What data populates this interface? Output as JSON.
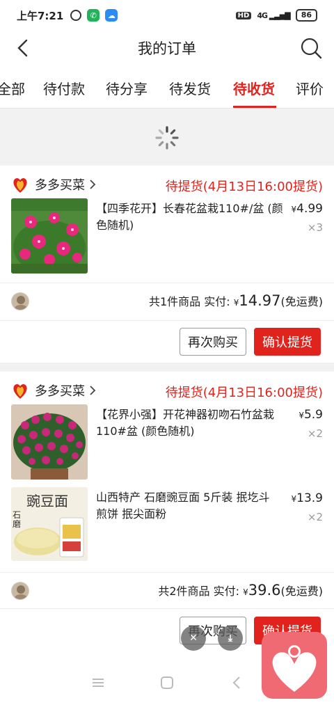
{
  "status_bar": {
    "time": "上午7:21",
    "hd": "HD",
    "network": "4G",
    "battery": "86"
  },
  "header": {
    "title": "我的订单"
  },
  "tabs": [
    "全部",
    "待付款",
    "待分享",
    "待发货",
    "待收货",
    "评价"
  ],
  "active_tab": "待收货",
  "orders": [
    {
      "shop": "多多买菜",
      "status": "待提货(4月13日16:00提货)",
      "items": [
        {
          "name": "【四季花开】长春花盆栽110#/盆 (颜色随机)",
          "price": "4.99",
          "qty": "×3",
          "image_icon": "pink-flower-pot-image"
        }
      ],
      "summary_count": "共1件商品",
      "summary_label": "实付:",
      "summary_amount": "14.97",
      "summary_note": "(免运费)",
      "btn_rebuy": "再次购买",
      "btn_confirm": "确认提货"
    },
    {
      "shop": "多多买菜",
      "status": "待提货(4月13日16:00提货)",
      "items": [
        {
          "name": "【花界小强】开花神器初吻石竹盆栽110#盆 (颜色随机)",
          "price": "5.9",
          "qty": "×2",
          "image_icon": "dianthus-flower-image"
        },
        {
          "name": "山西特产 石磨豌豆面 5斤装 抿圪斗 煎饼 抿尖面粉",
          "price": "13.9",
          "qty": "×2",
          "image_icon": "pea-flour-bag-image"
        }
      ],
      "summary_count": "共2件商品",
      "summary_label": "实付:",
      "summary_amount": "39.6",
      "summary_note": "(免运费)",
      "btn_rebuy": "再次购买",
      "btn_confirm": "确认提货"
    }
  ],
  "currency": "¥",
  "pea_flour_label": "豌豆面",
  "pea_flour_side": "石磨",
  "colors": {
    "accent": "#e0231d",
    "float_app": "#ef6a73"
  }
}
